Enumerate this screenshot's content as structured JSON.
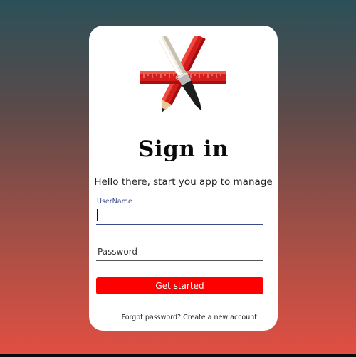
{
  "login_form": {
    "title": "Sign in",
    "subtitle": "Hello there, start you app to manage",
    "username": {
      "label": "UserName",
      "value": ""
    },
    "password": {
      "placeholder": "Password",
      "value": ""
    },
    "submit_label": "Get started",
    "forgot_password_link": "Forgot password?",
    "create_account_link": "Create a new account"
  },
  "logo": {
    "icon": "pencil-ruler-brush-logo"
  },
  "colors": {
    "background_top": "#2b5058",
    "background_bottom": "#e24f42",
    "card": "#ffffff",
    "button": "#ff0000",
    "field_accent": "#3b4a8a"
  }
}
